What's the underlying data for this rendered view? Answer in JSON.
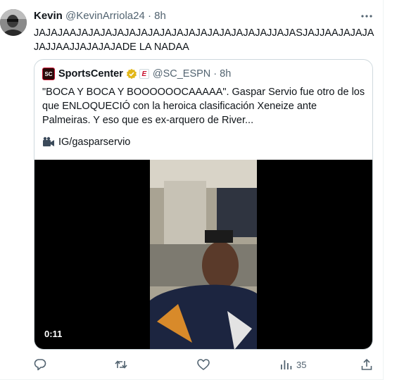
{
  "tweet": {
    "author_name": "Kevin",
    "author_handle": "@KevinArriola24",
    "separator": "·",
    "time": "8h",
    "text": "JAJAJAAJAJAJAJAJAJAJAJAJAJAJAJAJAJAJAJAJJAJASJAJJAAJAJAJAJAJJAAJJAJAJAJADE LA NADAA"
  },
  "quote": {
    "author_name": "SportsCenter",
    "logo_text": "SC",
    "affiliate_glyph": "E",
    "author_handle": "@SC_ESPN",
    "separator": "·",
    "time": "8h",
    "text": "\"BOCA Y BOCA Y BOOOOOOCAAAAA\". Gaspar Servio fue otro de los que ENLOQUECIÓ con la heroica clasificación Xeneize  ante Palmeiras. Y eso que es ex-arquero de River...",
    "credit": "IG/gasparservio",
    "video_duration": "0:11"
  },
  "actions": {
    "views": "35"
  },
  "icons": {
    "more": "more-icon",
    "verified": "verified-badge-icon",
    "camera": "video-camera-icon",
    "reply": "reply-icon",
    "retweet": "retweet-icon",
    "like": "like-icon",
    "views": "views-icon",
    "share": "share-icon"
  },
  "colors": {
    "text_primary": "#0f1419",
    "text_secondary": "#536471",
    "border": "#cfd9de",
    "verified_gold": "#e2b719"
  }
}
